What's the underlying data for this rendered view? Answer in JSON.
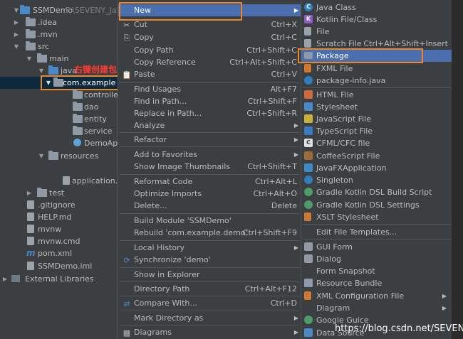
{
  "project": {
    "root": "SSMDemo",
    "root_path": "F:\\SEVENY_Java",
    "items": [
      {
        "label": ".idea"
      },
      {
        "label": ".mvn"
      },
      {
        "label": "src"
      },
      {
        "label": "main"
      },
      {
        "label": "java"
      },
      {
        "label": "com.example"
      },
      {
        "label": "controller"
      },
      {
        "label": "dao"
      },
      {
        "label": "entity"
      },
      {
        "label": "service"
      },
      {
        "label": "DemoApp"
      },
      {
        "label": "resources"
      },
      {
        "label": "application.pr"
      },
      {
        "label": "test"
      },
      {
        "label": ".gitignore"
      },
      {
        "label": "HELP.md"
      },
      {
        "label": "mvnw"
      },
      {
        "label": "mvnw.cmd"
      },
      {
        "label": "pom.xml"
      },
      {
        "label": "SSMDemo.iml"
      },
      {
        "label": "External Libraries"
      }
    ],
    "annotation": "右键创建包"
  },
  "context_menu": {
    "items": [
      {
        "label": "New",
        "shortcut": ""
      },
      {
        "label": "Cut",
        "shortcut": "Ctrl+X"
      },
      {
        "label": "Copy",
        "shortcut": "Ctrl+C"
      },
      {
        "label": "Copy Path",
        "shortcut": "Ctrl+Shift+C"
      },
      {
        "label": "Copy Reference",
        "shortcut": "Ctrl+Alt+Shift+C"
      },
      {
        "label": "Paste",
        "shortcut": "Ctrl+V"
      },
      {
        "label": "Find Usages",
        "shortcut": "Alt+F7"
      },
      {
        "label": "Find in Path...",
        "shortcut": "Ctrl+Shift+F"
      },
      {
        "label": "Replace in Path...",
        "shortcut": "Ctrl+Shift+R"
      },
      {
        "label": "Analyze",
        "shortcut": ""
      },
      {
        "label": "Refactor",
        "shortcut": ""
      },
      {
        "label": "Add to Favorites",
        "shortcut": ""
      },
      {
        "label": "Show Image Thumbnails",
        "shortcut": "Ctrl+Shift+T"
      },
      {
        "label": "Reformat Code",
        "shortcut": "Ctrl+Alt+L"
      },
      {
        "label": "Optimize Imports",
        "shortcut": "Ctrl+Alt+O"
      },
      {
        "label": "Delete...",
        "shortcut": "Delete"
      },
      {
        "label": "Build Module 'SSMDemo'",
        "shortcut": ""
      },
      {
        "label": "Rebuild 'com.example.demo'",
        "shortcut": "Ctrl+Shift+F9"
      },
      {
        "label": "Local History",
        "shortcut": ""
      },
      {
        "label": "Synchronize 'demo'",
        "shortcut": ""
      },
      {
        "label": "Show in Explorer",
        "shortcut": ""
      },
      {
        "label": "Directory Path",
        "shortcut": "Ctrl+Alt+F12"
      },
      {
        "label": "Compare With...",
        "shortcut": "Ctrl+D"
      },
      {
        "label": "Mark Directory as",
        "shortcut": ""
      },
      {
        "label": "Diagrams",
        "shortcut": ""
      }
    ]
  },
  "new_submenu": {
    "items": [
      {
        "label": "Java Class",
        "shortcut": ""
      },
      {
        "label": "Kotlin File/Class",
        "shortcut": ""
      },
      {
        "label": "File",
        "shortcut": ""
      },
      {
        "label": "Scratch File",
        "shortcut": "Ctrl+Alt+Shift+Insert"
      },
      {
        "label": "Package",
        "shortcut": ""
      },
      {
        "label": "FXML File",
        "shortcut": ""
      },
      {
        "label": "package-info.java",
        "shortcut": ""
      },
      {
        "label": "HTML File",
        "shortcut": ""
      },
      {
        "label": "Stylesheet",
        "shortcut": ""
      },
      {
        "label": "JavaScript File",
        "shortcut": ""
      },
      {
        "label": "TypeScript File",
        "shortcut": ""
      },
      {
        "label": "CFML/CFC file",
        "shortcut": ""
      },
      {
        "label": "CoffeeScript File",
        "shortcut": ""
      },
      {
        "label": "JavaFXApplication",
        "shortcut": ""
      },
      {
        "label": "Singleton",
        "shortcut": ""
      },
      {
        "label": "Gradle Kotlin DSL Build Script",
        "shortcut": ""
      },
      {
        "label": "Gradle Kotlin DSL Settings",
        "shortcut": ""
      },
      {
        "label": "XSLT Stylesheet",
        "shortcut": ""
      },
      {
        "label": "Edit File Templates...",
        "shortcut": ""
      },
      {
        "label": "GUI Form",
        "shortcut": ""
      },
      {
        "label": "Dialog",
        "shortcut": ""
      },
      {
        "label": "Form Snapshot",
        "shortcut": ""
      },
      {
        "label": "Resource Bundle",
        "shortcut": ""
      },
      {
        "label": "XML Configuration File",
        "shortcut": ""
      },
      {
        "label": "Diagram",
        "shortcut": ""
      },
      {
        "label": "Google Guice",
        "shortcut": ""
      },
      {
        "label": "Data Source",
        "shortcut": ""
      }
    ]
  },
  "watermark": "https://blog.csdn.net/SEVENY_",
  "colors": {
    "selection": "#4b6eaf",
    "highlight_box": "#e8872c",
    "annotation": "#ff3b30",
    "menu_bg": "#3c3f41"
  }
}
